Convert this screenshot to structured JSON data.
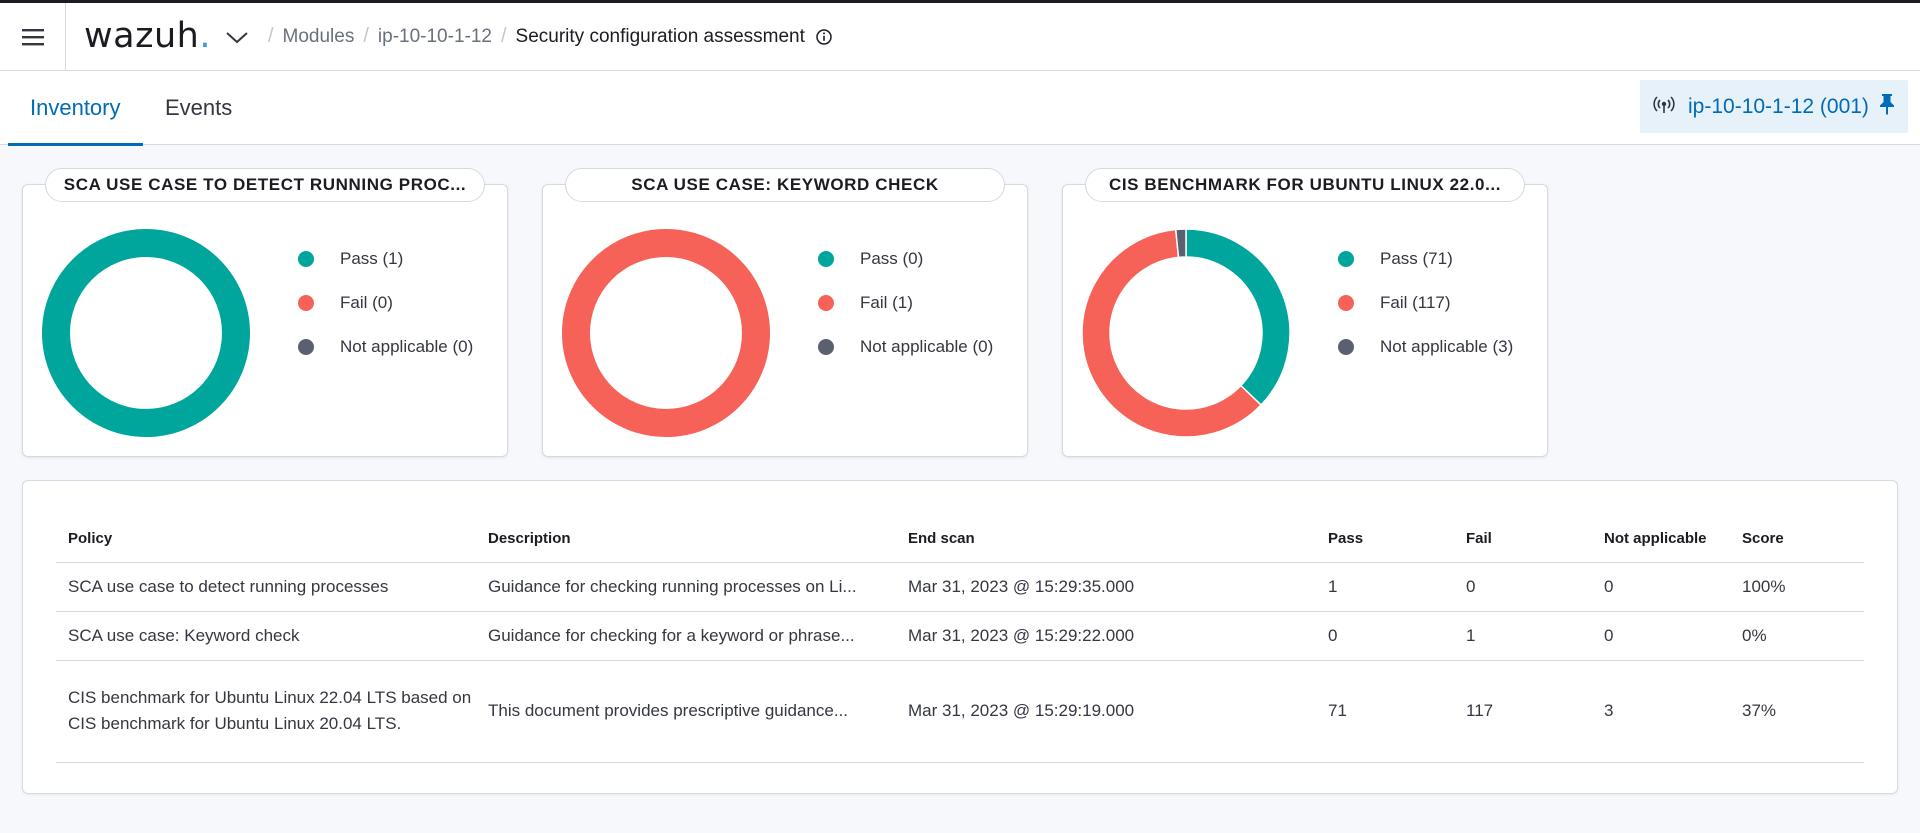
{
  "header": {
    "logo_text": "wazuh",
    "logo_dot": ".",
    "breadcrumbs": [
      {
        "label": "Modules"
      },
      {
        "label": "ip-10-10-1-12"
      },
      {
        "label": "Security configuration assessment"
      }
    ],
    "icons": {
      "menu": "hamburger-menu-icon",
      "logo_menu": "chevron-down-icon",
      "info": "info-icon"
    }
  },
  "tabs": [
    {
      "label": "Inventory",
      "active": true
    },
    {
      "label": "Events",
      "active": false
    }
  ],
  "agent": {
    "label": "ip-10-10-1-12 (001)",
    "icons": {
      "status": "wireless-signal-icon",
      "pin": "pin-icon"
    }
  },
  "colors": {
    "pass": "#00a69b",
    "fail": "#f66158",
    "not_applicable": "#5a6070",
    "accent": "#006bb8"
  },
  "cards": [
    {
      "title": "SCA USE CASE TO DETECT RUNNING PROC...",
      "legend": [
        {
          "label": "Pass (1)"
        },
        {
          "label": "Fail (0)"
        },
        {
          "label": "Not applicable (0)"
        }
      ],
      "chart_data": {
        "type": "pie",
        "donut": true,
        "categories": [
          "Pass",
          "Fail",
          "Not applicable"
        ],
        "values": [
          1,
          0,
          0
        ]
      }
    },
    {
      "title": "SCA USE CASE: KEYWORD CHECK",
      "legend": [
        {
          "label": "Pass (0)"
        },
        {
          "label": "Fail (1)"
        },
        {
          "label": "Not applicable (0)"
        }
      ],
      "chart_data": {
        "type": "pie",
        "donut": true,
        "categories": [
          "Pass",
          "Fail",
          "Not applicable"
        ],
        "values": [
          0,
          1,
          0
        ]
      }
    },
    {
      "title": "CIS BENCHMARK FOR UBUNTU LINUX 22.0...",
      "legend": [
        {
          "label": "Pass (71)"
        },
        {
          "label": "Fail (117)"
        },
        {
          "label": "Not applicable (3)"
        }
      ],
      "chart_data": {
        "type": "pie",
        "donut": true,
        "categories": [
          "Pass",
          "Fail",
          "Not applicable"
        ],
        "values": [
          71,
          117,
          3
        ]
      }
    }
  ],
  "table": {
    "columns": [
      "Policy",
      "Description",
      "End scan",
      "Pass",
      "Fail",
      "Not applicable",
      "Score"
    ],
    "rows": [
      {
        "policy": "SCA use case to detect running processes",
        "description": "Guidance for checking running processes on Li...",
        "end_scan": "Mar 31, 2023 @ 15:29:35.000",
        "pass": "1",
        "fail": "0",
        "na": "0",
        "score": "100%"
      },
      {
        "policy": "SCA use case: Keyword check",
        "description": "Guidance for checking for a keyword or phrase...",
        "end_scan": "Mar 31, 2023 @ 15:29:22.000",
        "pass": "0",
        "fail": "1",
        "na": "0",
        "score": "0%"
      },
      {
        "policy": "CIS benchmark for Ubuntu Linux 22.04 LTS based on CIS benchmark for Ubuntu Linux 20.04 LTS.",
        "description": "This document provides prescriptive guidance...",
        "end_scan": "Mar 31, 2023 @ 15:29:19.000",
        "pass": "71",
        "fail": "117",
        "na": "3",
        "score": "37%"
      }
    ]
  }
}
